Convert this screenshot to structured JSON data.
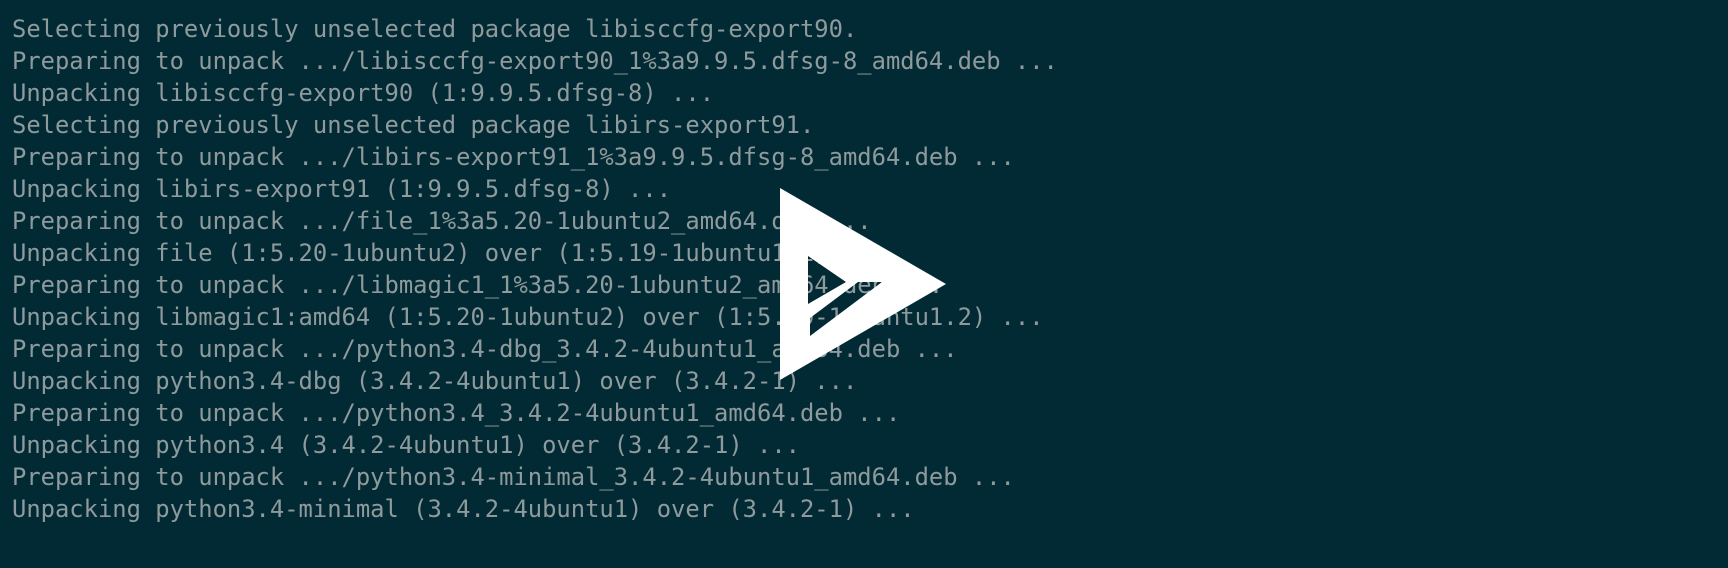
{
  "terminal": {
    "background_color": "#022a34",
    "text_color": "#8f9a9c",
    "lines": [
      "Selecting previously unselected package libisccfg-export90.",
      "Preparing to unpack .../libisccfg-export90_1%3a9.9.5.dfsg-8_amd64.deb ...",
      "Unpacking libisccfg-export90 (1:9.9.5.dfsg-8) ...",
      "Selecting previously unselected package libirs-export91.",
      "Preparing to unpack .../libirs-export91_1%3a9.9.5.dfsg-8_amd64.deb ...",
      "Unpacking libirs-export91 (1:9.9.5.dfsg-8) ...",
      "Preparing to unpack .../file_1%3a5.20-1ubuntu2_amd64.deb ...",
      "Unpacking file (1:5.20-1ubuntu2) over (1:5.19-1ubuntu1.2) ...",
      "Preparing to unpack .../libmagic1_1%3a5.20-1ubuntu2_amd64.deb ...",
      "Unpacking libmagic1:amd64 (1:5.20-1ubuntu2) over (1:5.19-1ubuntu1.2) ...",
      "Preparing to unpack .../python3.4-dbg_3.4.2-4ubuntu1_amd64.deb ...",
      "Unpacking python3.4-dbg (3.4.2-4ubuntu1) over (3.4.2-1) ...",
      "Preparing to unpack .../python3.4_3.4.2-4ubuntu1_amd64.deb ...",
      "Unpacking python3.4 (3.4.2-4ubuntu1) over (3.4.2-1) ...",
      "Preparing to unpack .../python3.4-minimal_3.4.2-4ubuntu1_amd64.deb ...",
      "Unpacking python3.4-minimal (3.4.2-4ubuntu1) over (3.4.2-1) ..."
    ]
  },
  "overlay": {
    "icon": "play-icon",
    "color": "#ffffff"
  }
}
